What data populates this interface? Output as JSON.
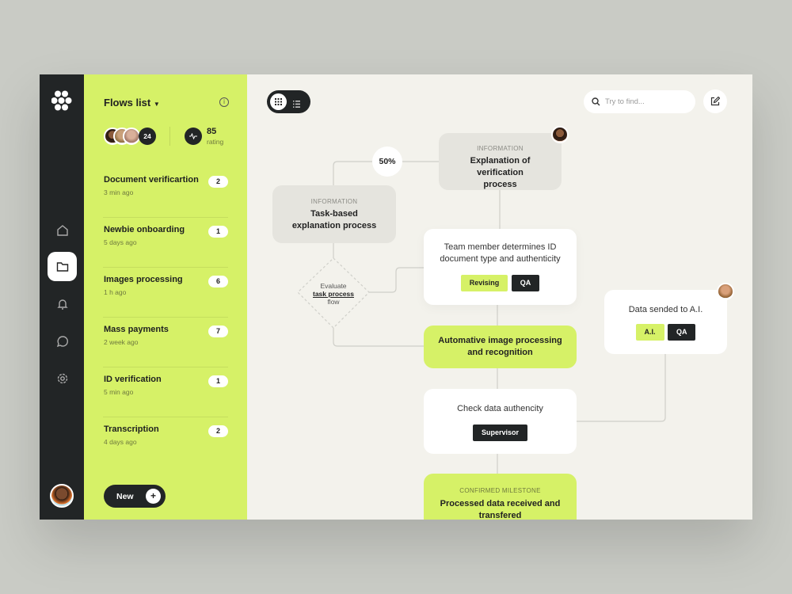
{
  "sidebar": {
    "items": [
      "home",
      "flows",
      "notifications",
      "messages",
      "settings"
    ],
    "active": "flows"
  },
  "panel": {
    "title": "Flows list",
    "member_count": "24",
    "rating_value": "85",
    "rating_label": "rating",
    "flows": [
      {
        "name": "Document verificartion",
        "time": "3 min ago",
        "count": "2"
      },
      {
        "name": "Newbie onboarding",
        "time": "5 days ago",
        "count": "1"
      },
      {
        "name": "Images processing",
        "time": "1 h ago",
        "count": "6"
      },
      {
        "name": "Mass payments",
        "time": "2 week ago",
        "count": "7"
      },
      {
        "name": "ID verification",
        "time": "5 min ago",
        "count": "1"
      },
      {
        "name": "Transcription",
        "time": "4 days ago",
        "count": "2"
      }
    ],
    "new_label": "New"
  },
  "toolbar": {
    "search_placeholder": "Try to find..."
  },
  "canvas": {
    "progress": "50%",
    "info1": {
      "caption": "INFORMATION",
      "title": "Task-based explanation process"
    },
    "info2": {
      "caption": "INFORMATION",
      "title": "Explanation of verification process"
    },
    "decision": {
      "line1": "Evaluate",
      "link": "task process",
      "line2": "flow"
    },
    "team": {
      "text": "Team member determines ID document type and authenticity",
      "tags": [
        "Revising",
        "QA"
      ]
    },
    "auto": {
      "title": "Automative image processing and recognition"
    },
    "check": {
      "text": "Check data authencity",
      "tags": [
        "Supervisor"
      ]
    },
    "milestone": {
      "caption": "CONFIRMED MILESTONE",
      "title": "Processed data received and transfered"
    },
    "ai": {
      "text": "Data sended to A.I.",
      "tags": [
        "A.I.",
        "QA"
      ]
    }
  },
  "colors": {
    "accent": "#d6f167",
    "dark": "#222526",
    "canvas": "#f3f2ec"
  }
}
